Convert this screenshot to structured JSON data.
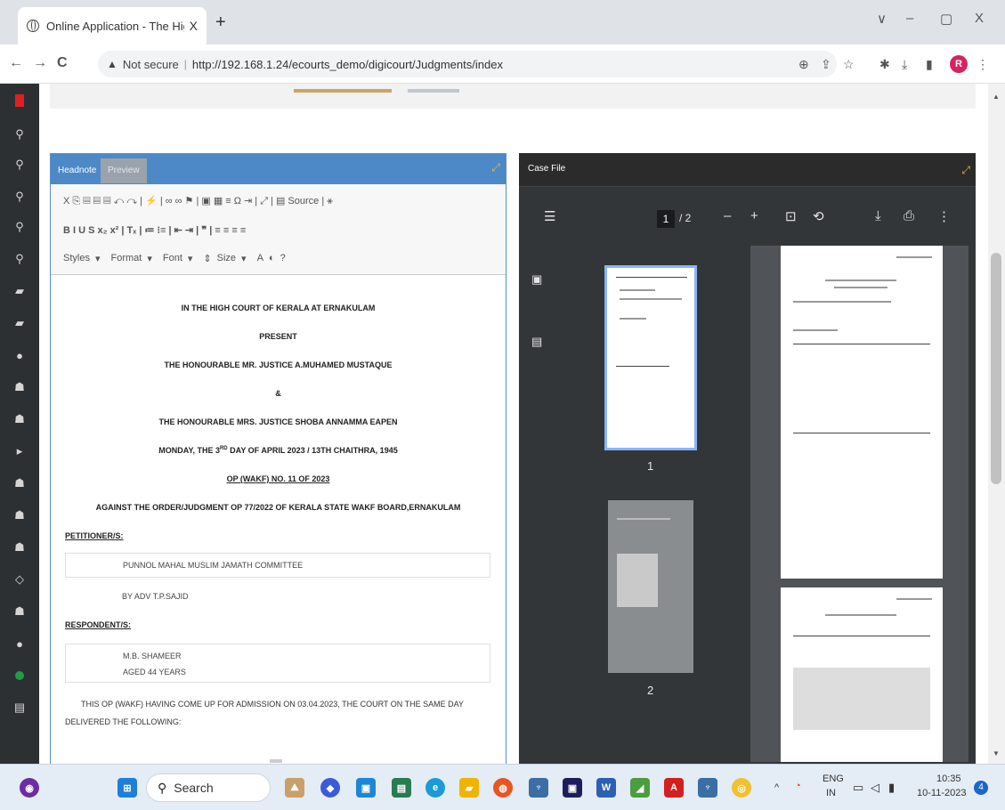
{
  "browser": {
    "tab_title": "Online Application - The High C",
    "tab_close": "X",
    "new_tab": "+",
    "window_controls": {
      "dropdown": "∨",
      "minimize": "–",
      "restore": "▢",
      "close": "X"
    },
    "nav": {
      "back": "←",
      "forward": "→",
      "reload": "C"
    },
    "security_icon": "▲",
    "not_secure": "Not secure",
    "url": "http://192.168.1.24/ecourts_demo/digicourt/Judgments/index",
    "profile_initial": "R"
  },
  "editor": {
    "tabs": {
      "headnote": "Headnote",
      "preview": "Preview"
    },
    "toolbar_row1": "X  ⎘  ▤  ▤  ▤  ↶  ↷  |  ⚡  |  ∞  ∞  ⚑  |  ▣  ▦  ≡  Ω  ⇥  |  ⤢  |  ▤ Source  |  ⚹",
    "toolbar_row2": "B  I  U  S  x₂  x²  |  Tₓ  |  ≔  ⁝≡  |  ⇤  ⇥  |  ❞  |  ≡  ≡  ≡  ≡",
    "styles": "Styles",
    "format": "Format",
    "font": "Font",
    "size": "Size",
    "help": "?",
    "doc": {
      "court": "IN THE HIGH COURT OF KERALA AT ERNAKULAM",
      "present": "PRESENT",
      "judge1": "THE HONOURABLE MR. JUSTICE A.MUHAMED MUSTAQUE",
      "amp": "&",
      "judge2": "THE HONOURABLE MRS. JUSTICE SHOBA ANNAMMA EAPEN",
      "date_prefix": "MONDAY, THE 3",
      "date_sup": "RD",
      "date_suffix": " DAY OF APRIL 2023 / 13TH CHAITHRA, 1945",
      "case_no": "OP (WAKF) NO. 11 OF 2023",
      "against": "AGAINST THE ORDER/JUDGMENT OP 77/2022 OF KERALA STATE WAKF BOARD,ERNAKULAM",
      "petitioner_label": "PETITIONER/S:",
      "petitioner": "PUNNOL MAHAL MUSLIM JAMATH COMMITTEE",
      "advocate": "BY ADV T.P.SAJID",
      "respondent_label": "RESPONDENT/S:",
      "respondent_name": "M.B. SHAMEER",
      "respondent_age": "AGED 44 YEARS",
      "body": "THIS OP (WAKF) HAVING COME UP FOR ADMISSION ON 03.04.2023, THE COURT ON THE SAME DAY DELIVERED THE FOLLOWING:"
    }
  },
  "casefile": {
    "title": "Case File",
    "page_current": "1",
    "page_total": "/ 2",
    "zoom_out": "–",
    "zoom_in": "+",
    "thumb1_label": "1",
    "thumb2_label": "2"
  },
  "taskbar": {
    "search": "Search",
    "language": "ENG",
    "region": "IN",
    "time": "10:35",
    "date": "10-11-2023",
    "notifications": "4"
  },
  "colors": {
    "editor_header": "#4c89c6",
    "casefile_bg": "#323639",
    "sidebar_bg": "#2d3033",
    "accent_gold": "#e8b84a",
    "profile": "#d5245f"
  }
}
